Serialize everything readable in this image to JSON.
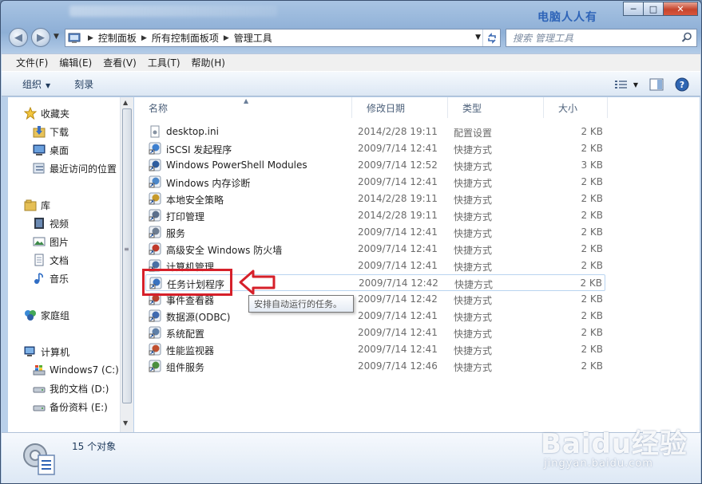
{
  "titlebar": {
    "watermark": "电脑人人有",
    "buttons": {
      "minimize": "─",
      "maximize": "□",
      "close": "✕"
    }
  },
  "nav": {
    "breadcrumb": [
      "控制面板",
      "所有控制面板项",
      "管理工具"
    ],
    "search_placeholder": "搜索 管理工具"
  },
  "menubar": {
    "items": [
      "文件(F)",
      "编辑(E)",
      "查看(V)",
      "工具(T)",
      "帮助(H)"
    ]
  },
  "commandbar": {
    "organize": "组织",
    "burn": "刻录"
  },
  "sidebar": {
    "favorites": {
      "label": "收藏夹",
      "items": [
        "下载",
        "桌面",
        "最近访问的位置"
      ]
    },
    "libraries": {
      "label": "库",
      "items": [
        "视频",
        "图片",
        "文档",
        "音乐"
      ]
    },
    "homegroup": "家庭组",
    "computer": {
      "label": "计算机",
      "items": [
        "Windows7 (C:)",
        "我的文档 (D:)",
        "备份资料 (E:)"
      ]
    }
  },
  "columns": {
    "name": "名称",
    "date": "修改日期",
    "type": "类型",
    "size": "大小"
  },
  "files": [
    {
      "name": "desktop.ini",
      "date": "2014/2/28 19:11",
      "type": "配置设置",
      "size": "2 KB",
      "icon": "ini-file-icon"
    },
    {
      "name": "iSCSI 发起程序",
      "date": "2009/7/14 12:41",
      "type": "快捷方式",
      "size": "2 KB",
      "icon": "iscsi-icon"
    },
    {
      "name": "Windows PowerShell Modules",
      "date": "2009/7/14 12:52",
      "type": "快捷方式",
      "size": "3 KB",
      "icon": "powershell-icon"
    },
    {
      "name": "Windows 内存诊断",
      "date": "2009/7/14 12:41",
      "type": "快捷方式",
      "size": "2 KB",
      "icon": "memory-diagnostic-icon"
    },
    {
      "name": "本地安全策略",
      "date": "2014/2/28 19:11",
      "type": "快捷方式",
      "size": "2 KB",
      "icon": "security-policy-icon"
    },
    {
      "name": "打印管理",
      "date": "2014/2/28 19:11",
      "type": "快捷方式",
      "size": "2 KB",
      "icon": "print-management-icon"
    },
    {
      "name": "服务",
      "date": "2009/7/14 12:41",
      "type": "快捷方式",
      "size": "2 KB",
      "icon": "services-icon"
    },
    {
      "name": "高级安全 Windows 防火墙",
      "date": "2009/7/14 12:41",
      "type": "快捷方式",
      "size": "2 KB",
      "icon": "firewall-icon"
    },
    {
      "name": "计算机管理",
      "date": "2009/7/14 12:41",
      "type": "快捷方式",
      "size": "2 KB",
      "icon": "computer-management-icon"
    },
    {
      "name": "任务计划程序",
      "date": "2009/7/14 12:42",
      "type": "快捷方式",
      "size": "2 KB",
      "icon": "task-scheduler-icon"
    },
    {
      "name": "事件查看器",
      "date": "2009/7/14 12:42",
      "type": "快捷方式",
      "size": "2 KB",
      "icon": "event-viewer-icon"
    },
    {
      "name": "数据源(ODBC)",
      "date": "2009/7/14 12:41",
      "type": "快捷方式",
      "size": "2 KB",
      "icon": "odbc-icon"
    },
    {
      "name": "系统配置",
      "date": "2009/7/14 12:41",
      "type": "快捷方式",
      "size": "2 KB",
      "icon": "system-config-icon"
    },
    {
      "name": "性能监视器",
      "date": "2009/7/14 12:41",
      "type": "快捷方式",
      "size": "2 KB",
      "icon": "performance-monitor-icon"
    },
    {
      "name": "组件服务",
      "date": "2009/7/14 12:46",
      "type": "快捷方式",
      "size": "2 KB",
      "icon": "component-services-icon"
    }
  ],
  "tooltip": "安排自动运行的任务。",
  "details": {
    "count": "15 个对象"
  },
  "watermark": {
    "logo": "Baidu经验",
    "url": "jingyan.baidu.com"
  },
  "colors": {
    "highlight": "#d6202a",
    "link": "#1e395b"
  }
}
